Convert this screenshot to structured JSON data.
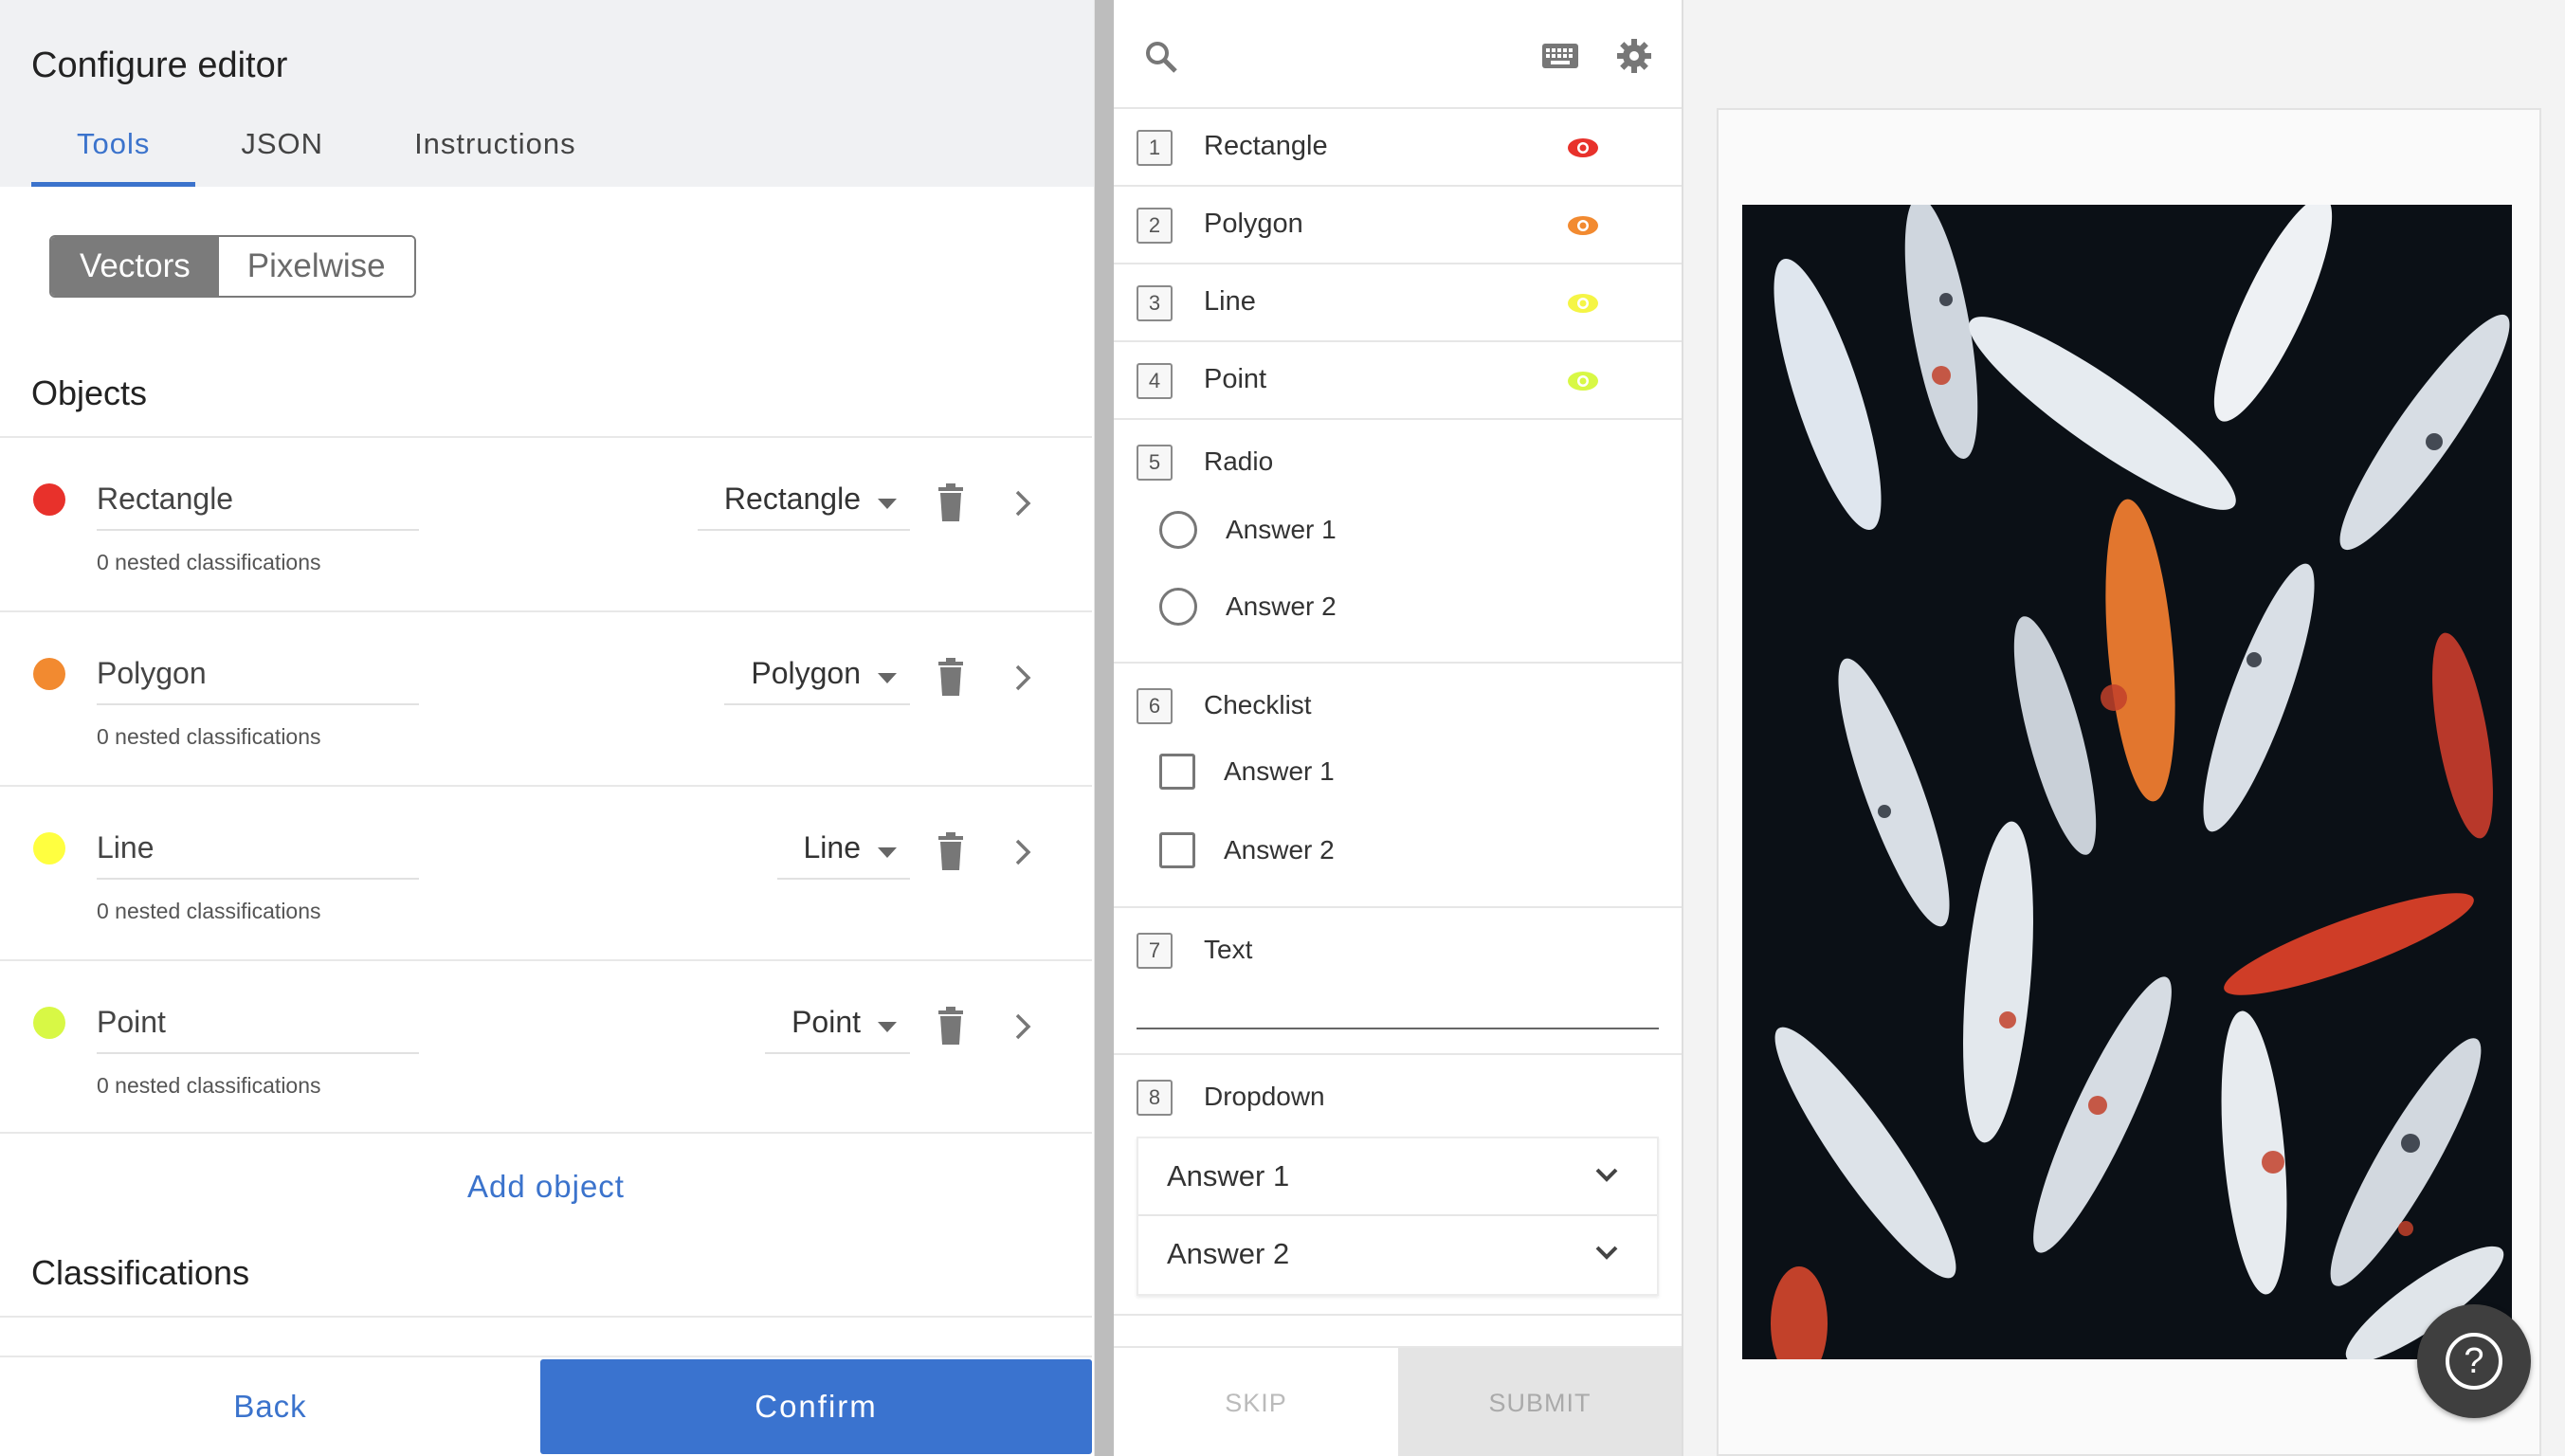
{
  "editor": {
    "title": "Configure editor",
    "tabs": [
      {
        "label": "Tools"
      },
      {
        "label": "JSON"
      },
      {
        "label": "Instructions"
      }
    ],
    "mode_toggle": {
      "vectors": "Vectors",
      "pixelwise": "Pixelwise",
      "selected": "Vectors"
    },
    "objects_title": "Objects",
    "objects": [
      {
        "name": "Rectangle",
        "type": "Rectangle",
        "nested": "0 nested classifications",
        "color": "#e8312b"
      },
      {
        "name": "Polygon",
        "type": "Polygon",
        "nested": "0 nested classifications",
        "color": "#f28a30"
      },
      {
        "name": "Line",
        "type": "Line",
        "nested": "0 nested classifications",
        "color": "#ffff40"
      },
      {
        "name": "Point",
        "type": "Point",
        "nested": "0 nested classifications",
        "color": "#d8f845"
      }
    ],
    "add_object": "Add object",
    "classifications_title": "Classifications",
    "back": "Back",
    "confirm": "Confirm",
    "accent": "#3a73cf"
  },
  "preview": {
    "tools": [
      {
        "num": "1",
        "label": "Rectangle",
        "eye_color": "#e8312b"
      },
      {
        "num": "2",
        "label": "Polygon",
        "eye_color": "#f28a30"
      },
      {
        "num": "3",
        "label": "Line",
        "eye_color": "#f5f545"
      },
      {
        "num": "4",
        "label": "Point",
        "eye_color": "#d8f845"
      }
    ],
    "radio": {
      "num": "5",
      "label": "Radio",
      "options": [
        "Answer 1",
        "Answer 2"
      ]
    },
    "checklist": {
      "num": "6",
      "label": "Checklist",
      "options": [
        "Answer 1",
        "Answer 2"
      ]
    },
    "text": {
      "num": "7",
      "label": "Text"
    },
    "dropdown": {
      "num": "8",
      "label": "Dropdown",
      "options": [
        "Answer 1",
        "Answer 2"
      ]
    },
    "skip": "SKIP",
    "submit": "SUBMIT"
  },
  "help": {
    "glyph": "?"
  }
}
